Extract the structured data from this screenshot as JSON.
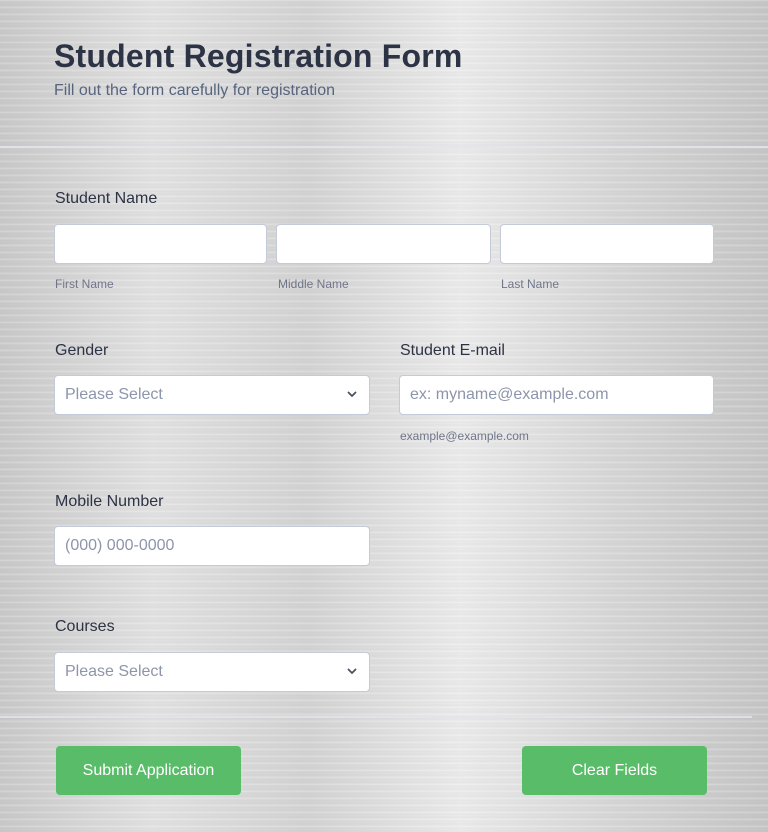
{
  "header": {
    "title": "Student Registration Form",
    "subtitle": "Fill out the form carefully for registration"
  },
  "student_name": {
    "label": "Student Name",
    "first": {
      "value": "",
      "sublabel": "First Name"
    },
    "middle": {
      "value": "",
      "sublabel": "Middle Name"
    },
    "last": {
      "value": "",
      "sublabel": "Last Name"
    }
  },
  "gender": {
    "label": "Gender",
    "selected": "Please Select",
    "icon": "chevron-down-icon"
  },
  "email": {
    "label": "Student E-mail",
    "placeholder": "ex: myname@example.com",
    "sublabel": "example@example.com"
  },
  "mobile": {
    "label": "Mobile Number",
    "placeholder": "(000) 000-0000"
  },
  "courses": {
    "label": "Courses",
    "selected": "Please Select",
    "icon": "chevron-down-icon"
  },
  "actions": {
    "submit_label": "Submit Application",
    "clear_label": "Clear Fields"
  },
  "colors": {
    "button": "#59bc69",
    "title": "#2c3345"
  }
}
